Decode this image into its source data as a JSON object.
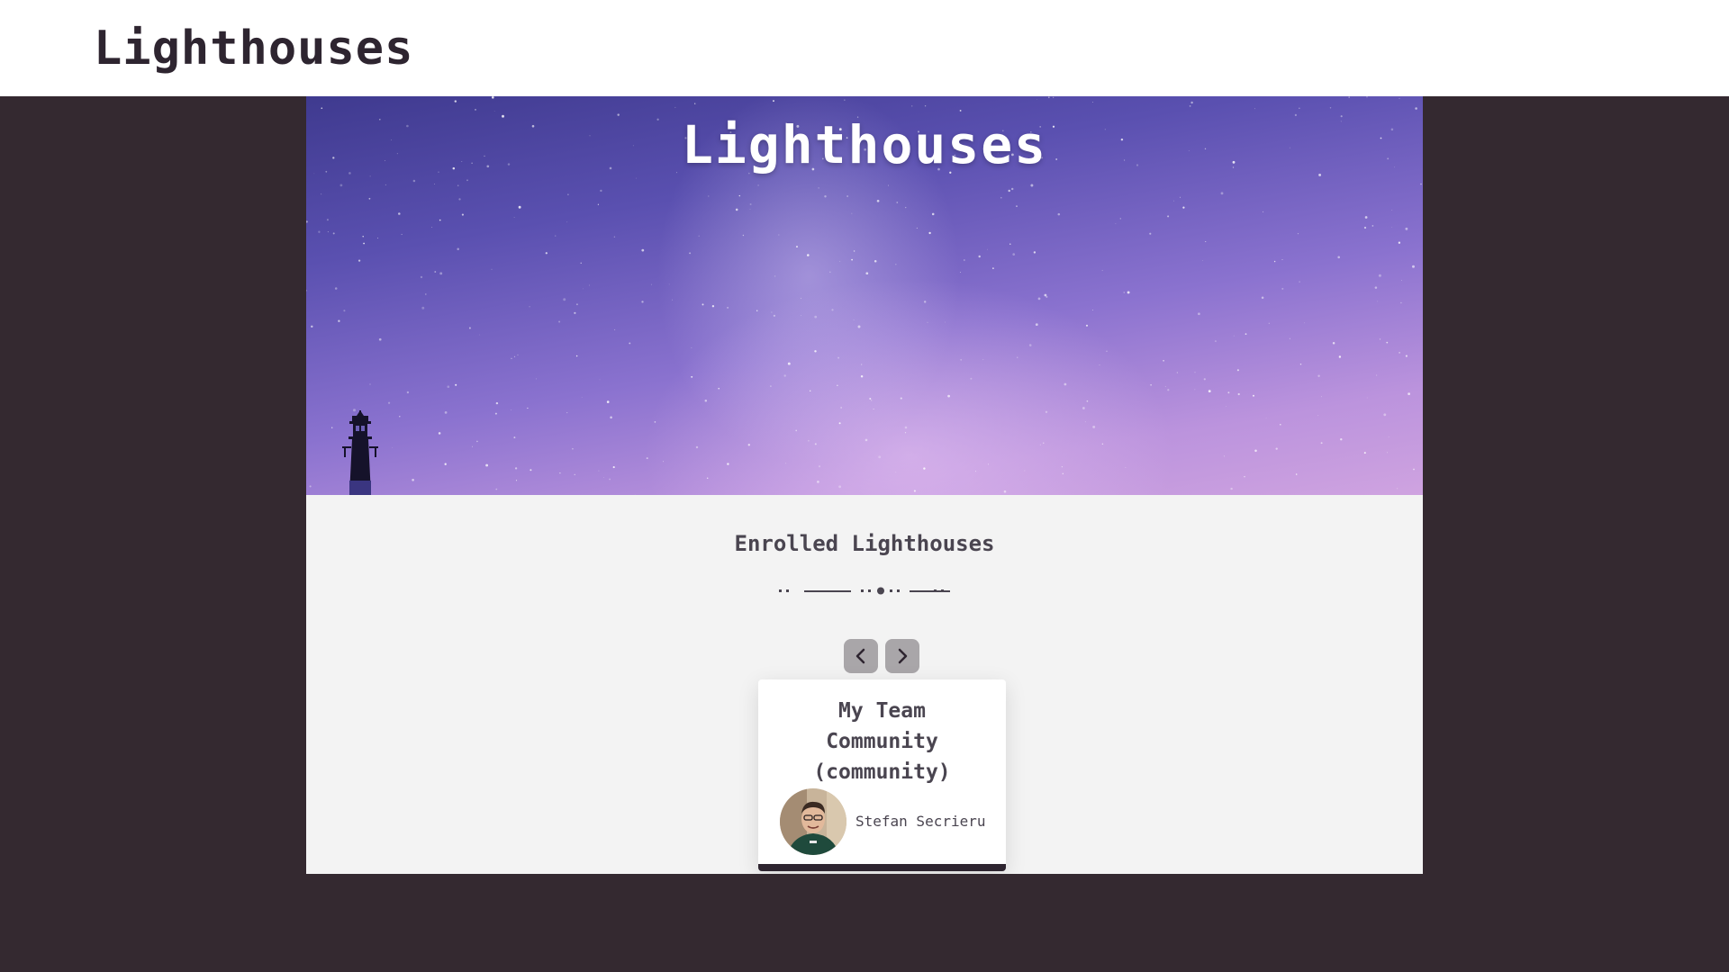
{
  "header": {
    "brand": "Lighthouses"
  },
  "hero": {
    "title": "Lighthouses"
  },
  "enrolled": {
    "title": "Enrolled Lighthouses",
    "prev_icon": "chevron-left-icon",
    "next_icon": "chevron-right-icon",
    "cards": [
      {
        "title": "My Team Community (community)",
        "owner": "Stefan Secrieru"
      }
    ]
  },
  "colors": {
    "page_background": "#342930",
    "header_background": "#ffffff",
    "section_background": "#f3f3f3",
    "text_dark": "#4a4550",
    "brand": "#2e2530",
    "nav_button": "#a9a6a9"
  }
}
